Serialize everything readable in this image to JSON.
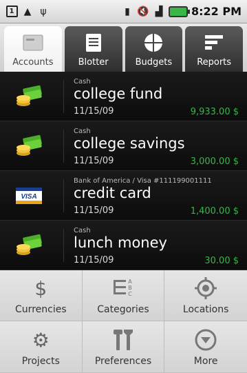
{
  "status_bar": {
    "time": "8:22 PM",
    "left_icons": [
      "sim-icon",
      "warning-icon",
      "usb-icon"
    ],
    "right_icons": [
      "sd-icon",
      "mute-icon",
      "signal-icon",
      "battery-icon"
    ],
    "sim_number": "1"
  },
  "tabs": [
    {
      "label": "Accounts",
      "icon": "accounts-icon",
      "active": true
    },
    {
      "label": "Blotter",
      "icon": "blotter-icon",
      "active": false
    },
    {
      "label": "Budgets",
      "icon": "budgets-icon",
      "active": false
    },
    {
      "label": "Reports",
      "icon": "reports-icon",
      "active": false
    }
  ],
  "accounts": [
    {
      "type": "Cash",
      "name": "college fund",
      "date": "11/15/09",
      "amount": "9,933.00 $",
      "icon": "cash-icon"
    },
    {
      "type": "Cash",
      "name": "college savings",
      "date": "11/15/09",
      "amount": "3,000.00 $",
      "icon": "cash-icon"
    },
    {
      "type": "Bank of America / Visa #111199001111",
      "name": "credit card",
      "date": "11/15/09",
      "amount": "1,400.00 $",
      "icon": "visa-card-icon"
    },
    {
      "type": "Cash",
      "name": "lunch money",
      "date": "11/15/09",
      "amount": "30.00 $",
      "icon": "cash-icon"
    }
  ],
  "visa_text": "VISA",
  "menu": [
    {
      "label": "Currencies",
      "icon": "dollar-icon"
    },
    {
      "label": "Categories",
      "icon": "categories-icon"
    },
    {
      "label": "Locations",
      "icon": "location-icon"
    },
    {
      "label": "Projects",
      "icon": "gear-icon"
    },
    {
      "label": "Preferences",
      "icon": "tools-icon"
    },
    {
      "label": "More",
      "icon": "more-icon"
    }
  ],
  "colors": {
    "amount_green": "#39b54a",
    "list_bg": "#0f0f0f",
    "menu_bg": "#dcdcdc"
  }
}
